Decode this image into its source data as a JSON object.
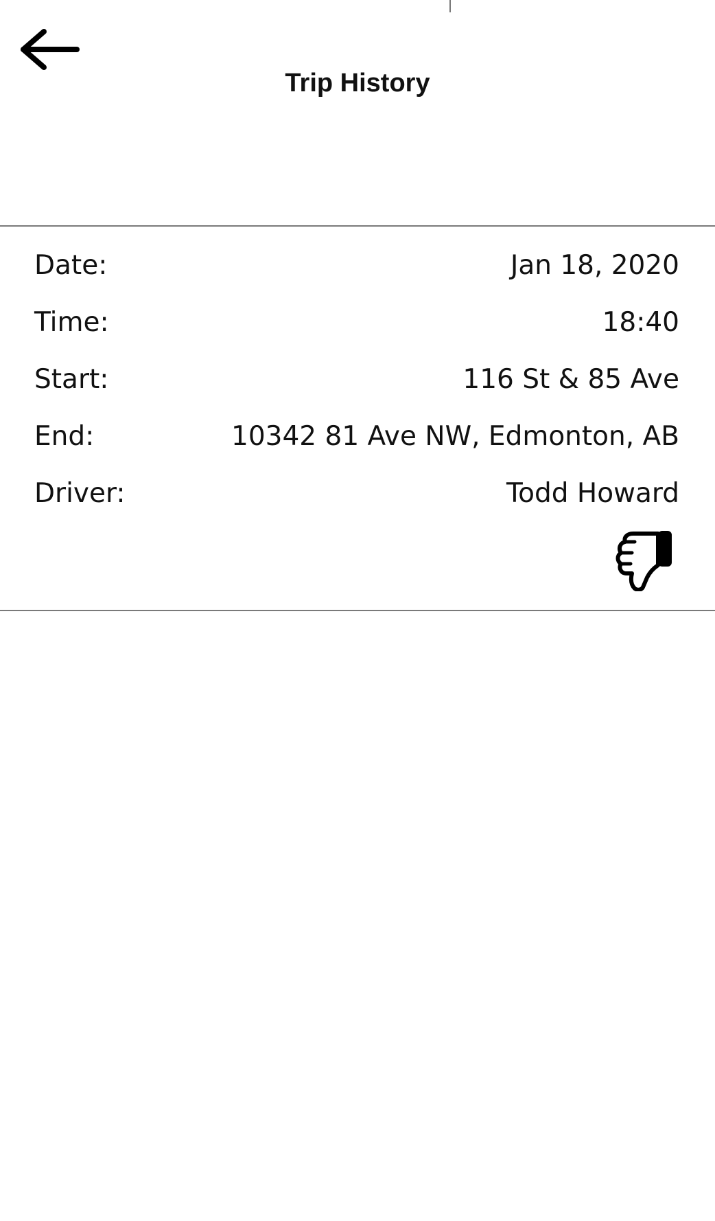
{
  "header": {
    "title": "Trip History",
    "back_icon": "arrow-left-icon"
  },
  "trip": {
    "fields": [
      {
        "label": "Date:",
        "value": "Jan 18, 2020"
      },
      {
        "label": "Time:",
        "value": "18:40"
      },
      {
        "label": "Start:",
        "value": "116 St & 85 Ave"
      },
      {
        "label": "End:",
        "value": "10342 81 Ave NW, Edmonton, AB"
      },
      {
        "label": "Driver:",
        "value": "Todd Howard"
      }
    ],
    "rating_icon": "thumbs-down-icon"
  }
}
